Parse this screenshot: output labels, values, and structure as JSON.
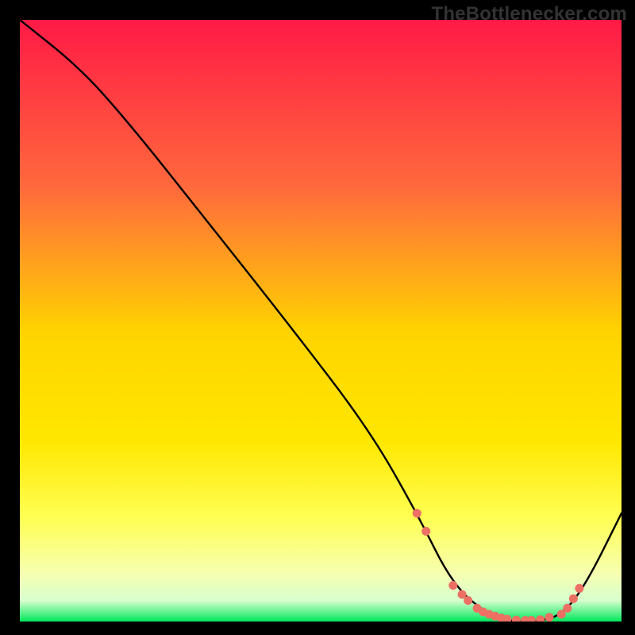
{
  "watermark": "TheBottlenecker.com",
  "colors": {
    "bg": "#000000",
    "top": "#ff1a46",
    "mid_upper": "#ff7a33",
    "mid": "#ffd400",
    "mid_lower": "#ffff55",
    "low_band": "#f6ffb0",
    "bottom": "#00e85b",
    "line": "#000000",
    "dot": "#ec7063"
  },
  "chart_data": {
    "type": "line",
    "title": "",
    "xlabel": "",
    "ylabel": "",
    "xlim": [
      0,
      100
    ],
    "ylim": [
      0,
      100
    ],
    "series": [
      {
        "name": "bottleneck-curve",
        "x": [
          0,
          10,
          18,
          30,
          45,
          58,
          66,
          72,
          78,
          82,
          86,
          90,
          94,
          100
        ],
        "y": [
          100,
          92,
          83,
          68,
          49,
          32,
          18,
          6,
          1,
          0,
          0,
          1,
          6,
          18
        ]
      }
    ],
    "markers": {
      "name": "highlight-dots",
      "x": [
        66,
        67.5,
        72,
        73.5,
        74.5,
        76,
        77,
        78,
        79,
        80,
        81,
        82.5,
        84,
        85,
        86.5,
        88,
        90,
        91,
        92,
        93
      ],
      "y": [
        18,
        15,
        6,
        4.5,
        3.5,
        2.2,
        1.6,
        1.2,
        0.9,
        0.6,
        0.4,
        0.25,
        0.2,
        0.2,
        0.3,
        0.7,
        1.2,
        2.2,
        3.8,
        5.5
      ]
    }
  }
}
